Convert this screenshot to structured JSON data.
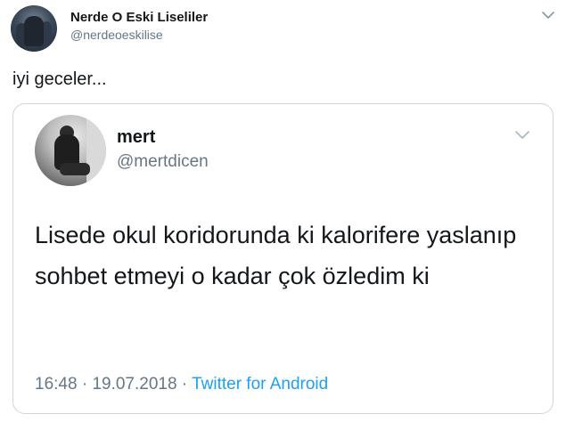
{
  "outer_tweet": {
    "display_name": "Nerde O Eski Liseliler",
    "handle": "@nerdeoeskilise",
    "text": "iyi geceler..."
  },
  "quoted_tweet": {
    "display_name": "mert",
    "handle": "@mertdicen",
    "text": "Lisede okul koridorunda ki kalorifere yaslanıp sohbet etmeyi o kadar çok özledim ki",
    "time": "16:48",
    "separator": " · ",
    "date": "19.07.2018",
    "source": "Twitter for Android"
  },
  "icons": {
    "outer_menu": "chevron-down-icon",
    "inner_menu": "chevron-down-icon"
  },
  "colors": {
    "text": "#14171a",
    "secondary": "#657786",
    "link": "#1da1f2",
    "border": "#ccd6dd"
  }
}
